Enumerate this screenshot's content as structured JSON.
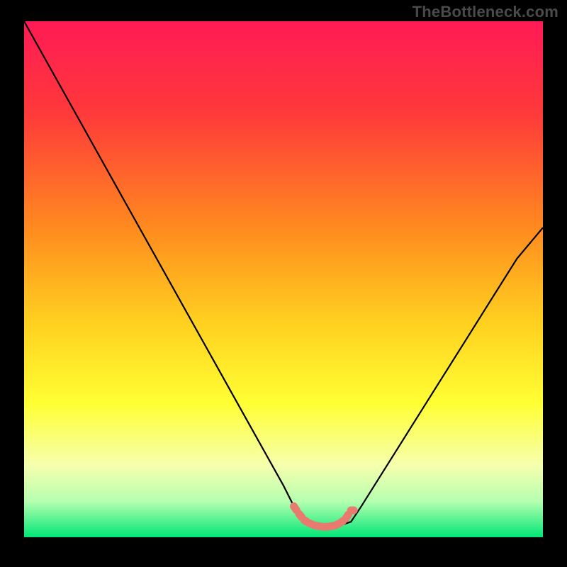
{
  "watermark": "TheBottleneck.com",
  "chart_data": {
    "type": "line",
    "title": "",
    "xlabel": "",
    "ylabel": "",
    "xlim": [
      0,
      100
    ],
    "ylim": [
      0,
      100
    ],
    "series": [
      {
        "name": "bottleneck-curve",
        "x": [
          0,
          5,
          10,
          15,
          20,
          25,
          30,
          35,
          40,
          45,
          50,
          52,
          55,
          58,
          60,
          63,
          65,
          70,
          75,
          80,
          85,
          90,
          95,
          100
        ],
        "y": [
          100,
          91,
          82,
          73,
          64,
          55,
          46,
          37,
          28,
          19,
          10,
          6,
          3,
          2,
          2,
          3,
          6,
          14,
          22,
          30,
          38,
          46,
          54,
          60
        ]
      }
    ],
    "highlight": {
      "name": "sweet-spot-marker",
      "x": [
        52,
        53,
        54,
        55,
        56,
        57,
        58,
        59,
        60,
        61,
        62,
        63
      ],
      "y": [
        6.0,
        4.5,
        3.3,
        2.7,
        2.3,
        2.1,
        2.0,
        2.1,
        2.3,
        2.8,
        3.6,
        5.2
      ]
    },
    "background_gradient": {
      "stops": [
        {
          "offset": 0.0,
          "color": "#ff1a55"
        },
        {
          "offset": 0.18,
          "color": "#ff3a3a"
        },
        {
          "offset": 0.4,
          "color": "#ff8a1f"
        },
        {
          "offset": 0.58,
          "color": "#ffcf1f"
        },
        {
          "offset": 0.74,
          "color": "#ffff33"
        },
        {
          "offset": 0.86,
          "color": "#f6ffad"
        },
        {
          "offset": 0.93,
          "color": "#b6ffb0"
        },
        {
          "offset": 1.0,
          "color": "#00e676"
        }
      ]
    },
    "colors": {
      "curve": "#000000",
      "highlight": "#e87a6f",
      "frame": "#000000"
    }
  }
}
